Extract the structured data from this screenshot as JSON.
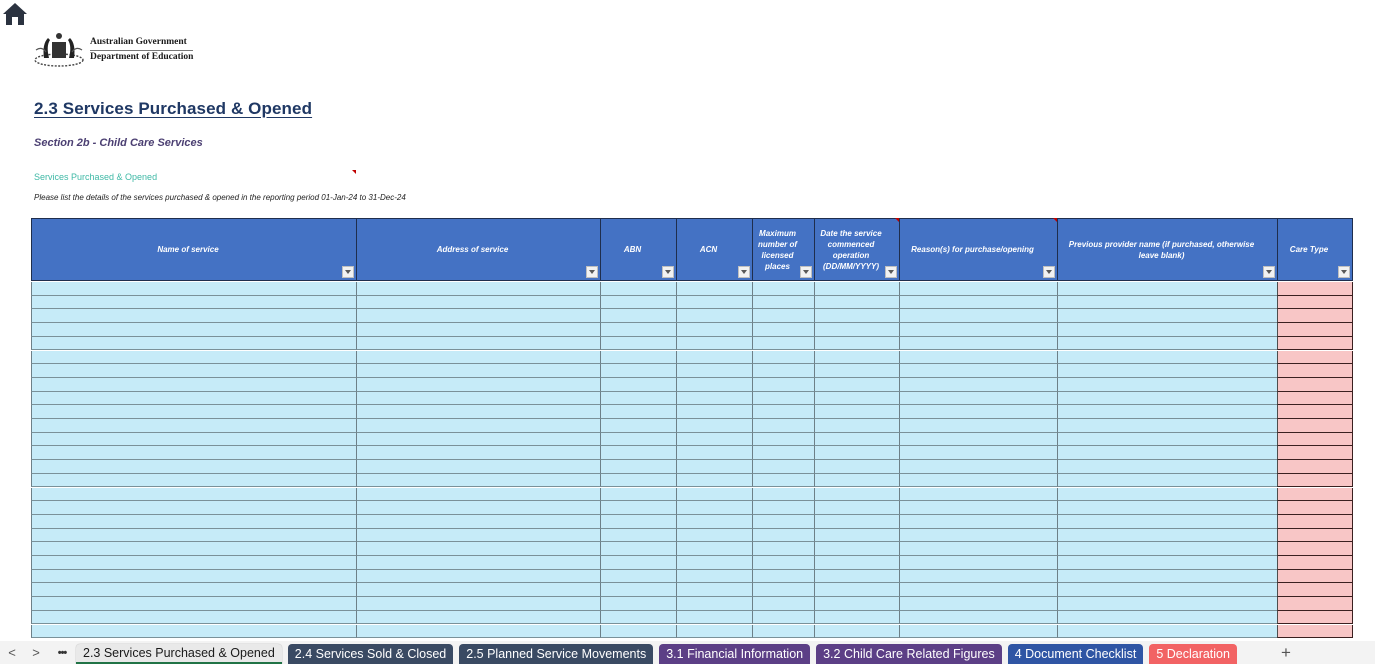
{
  "header": {
    "home_icon": "home-icon",
    "logo": {
      "line1": "Australian Government",
      "line2": "Department of Education"
    },
    "page_title": "2.3 Services Purchased & Opened",
    "section_title": "Section 2b  - Child Care Services",
    "sub_title": "Services Purchased & Opened",
    "instructions": "Please list the details of the services purchased & opened in the reporting period 01-Jan-24 to 31-Dec-24"
  },
  "table": {
    "columns": [
      {
        "label": "Name of service",
        "filter": true,
        "comment": false
      },
      {
        "label": "Address of service",
        "filter": true,
        "comment": false
      },
      {
        "label": "ABN",
        "filter": true,
        "comment": false
      },
      {
        "label": "ACN",
        "filter": true,
        "comment": false
      },
      {
        "label": "Maximum number of licensed places",
        "filter": true,
        "comment": false
      },
      {
        "label": "Date the service commenced operation (DD/MM/YYYY)",
        "filter": true,
        "comment": true
      },
      {
        "label": "Reason(s) for purchase/opening",
        "filter": true,
        "comment": true
      },
      {
        "label": "Previous provider name (if purchased, otherwise leave blank)",
        "filter": true,
        "comment": false
      },
      {
        "label": "Care Type",
        "filter": true,
        "comment": false
      }
    ],
    "row_count": 26,
    "colors": {
      "header_bg": "#4472c4",
      "input_cell_bg": "#c6ebf8",
      "care_type_cell_bg": "#f8c6c6"
    }
  },
  "sheet_tabs": {
    "nav": {
      "prev": "<",
      "next": ">",
      "more": "…"
    },
    "tabs": [
      {
        "label": "2.3 Services Purchased & Opened",
        "active": true,
        "color": "#e9e9e9"
      },
      {
        "label": "2.4 Services Sold & Closed",
        "active": false,
        "color": "#3a4a63"
      },
      {
        "label": "2.5 Planned Service Movements",
        "active": false,
        "color": "#3a4a63"
      },
      {
        "label": "3.1 Financial Information",
        "active": false,
        "color": "#5c3f86"
      },
      {
        "label": "3.2 Child Care Related Figures",
        "active": false,
        "color": "#5c3f86"
      },
      {
        "label": "4 Document Checklist",
        "active": false,
        "color": "#2f55a4"
      },
      {
        "label": "5 Declaration",
        "active": false,
        "color": "#f26364"
      }
    ],
    "add_label": "+"
  }
}
